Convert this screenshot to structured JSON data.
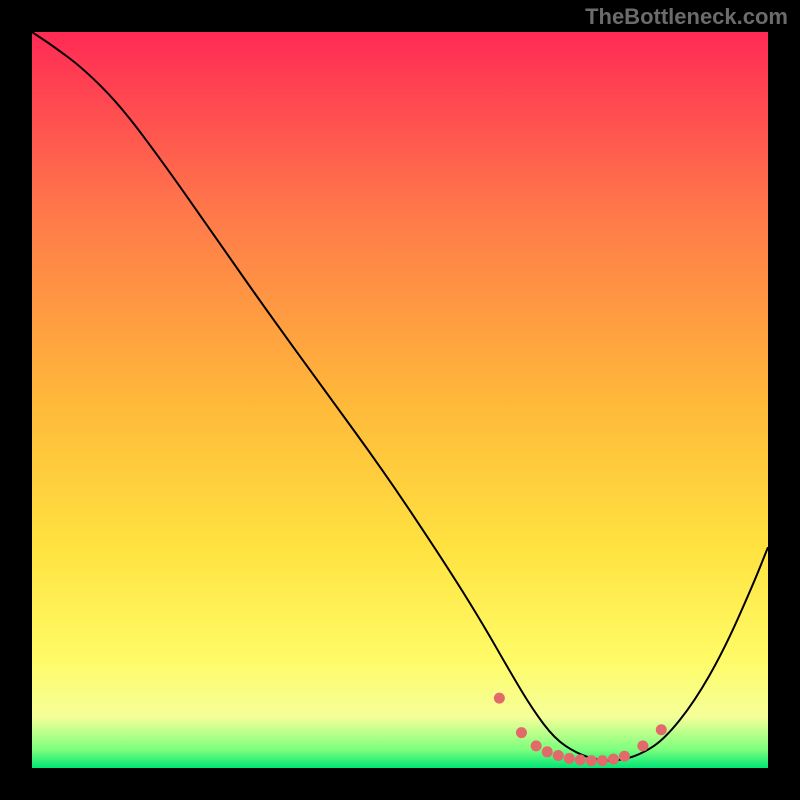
{
  "watermark": "TheBottleneck.com",
  "chart_data": {
    "type": "line",
    "title": "",
    "xlabel": "",
    "ylabel": "",
    "xlim": [
      0,
      100
    ],
    "ylim": [
      0,
      100
    ],
    "grid": false,
    "legend": false,
    "gradient_stops": [
      {
        "offset": 0.0,
        "color": "#ff2a55"
      },
      {
        "offset": 0.25,
        "color": "#ff7a4a"
      },
      {
        "offset": 0.5,
        "color": "#ffb83a"
      },
      {
        "offset": 0.7,
        "color": "#ffe240"
      },
      {
        "offset": 0.85,
        "color": "#fffb66"
      },
      {
        "offset": 0.93,
        "color": "#f6ff99"
      },
      {
        "offset": 0.975,
        "color": "#7dff7d"
      },
      {
        "offset": 1.0,
        "color": "#00e676"
      }
    ],
    "series": [
      {
        "name": "bottleneck-curve",
        "x": [
          0,
          3,
          7,
          12,
          18,
          25,
          32,
          40,
          48,
          56,
          61,
          65,
          68,
          71,
          74,
          77,
          80,
          83,
          86,
          90,
          94,
          98,
          100
        ],
        "y": [
          100,
          98,
          95,
          90,
          82,
          72,
          62,
          51,
          40,
          28,
          20,
          13,
          8,
          4,
          2,
          1,
          1,
          2,
          4,
          9,
          16,
          25,
          30
        ]
      }
    ],
    "markers": {
      "name": "highlight-dots",
      "color": "#e36a6a",
      "points": [
        {
          "x": 63.5,
          "y": 9.5
        },
        {
          "x": 66.5,
          "y": 4.8
        },
        {
          "x": 68.5,
          "y": 3.0
        },
        {
          "x": 70.0,
          "y": 2.2
        },
        {
          "x": 71.5,
          "y": 1.7
        },
        {
          "x": 73.0,
          "y": 1.3
        },
        {
          "x": 74.5,
          "y": 1.1
        },
        {
          "x": 76.0,
          "y": 1.0
        },
        {
          "x": 77.5,
          "y": 1.0
        },
        {
          "x": 79.0,
          "y": 1.2
        },
        {
          "x": 80.5,
          "y": 1.6
        },
        {
          "x": 83.0,
          "y": 3.0
        },
        {
          "x": 85.5,
          "y": 5.2
        }
      ]
    }
  }
}
